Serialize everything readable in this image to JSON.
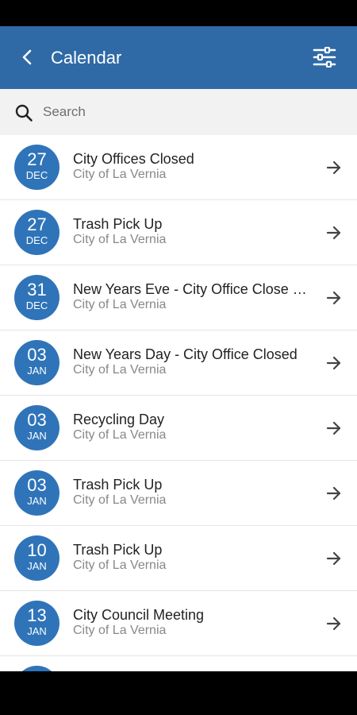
{
  "header": {
    "title": "Calendar",
    "back_icon": "chevron-left-icon",
    "filter_icon": "sliders-icon",
    "color": "#2f6aa6"
  },
  "search": {
    "placeholder": "Search",
    "icon": "search-icon"
  },
  "events": [
    {
      "day": "27",
      "month": "DEC",
      "title": "City Offices Closed",
      "subtitle": "City of La Vernia"
    },
    {
      "day": "27",
      "month": "DEC",
      "title": "Trash Pick Up",
      "subtitle": "City of La Vernia"
    },
    {
      "day": "31",
      "month": "DEC",
      "title": "New Years Eve - City Office Close at…",
      "subtitle": "City of La Vernia"
    },
    {
      "day": "03",
      "month": "JAN",
      "title": "New Years Day - City Office Closed",
      "subtitle": "City of La Vernia"
    },
    {
      "day": "03",
      "month": "JAN",
      "title": "Recycling Day",
      "subtitle": "City of La Vernia"
    },
    {
      "day": "03",
      "month": "JAN",
      "title": "Trash Pick Up",
      "subtitle": "City of La Vernia"
    },
    {
      "day": "10",
      "month": "JAN",
      "title": "Trash Pick Up",
      "subtitle": "City of La Vernia"
    },
    {
      "day": "13",
      "month": "JAN",
      "title": "City Council Meeting",
      "subtitle": "City of La Vernia"
    },
    {
      "day": "",
      "month": "",
      "title": "",
      "subtitle": ""
    }
  ],
  "badge_color": "#2f74b8"
}
